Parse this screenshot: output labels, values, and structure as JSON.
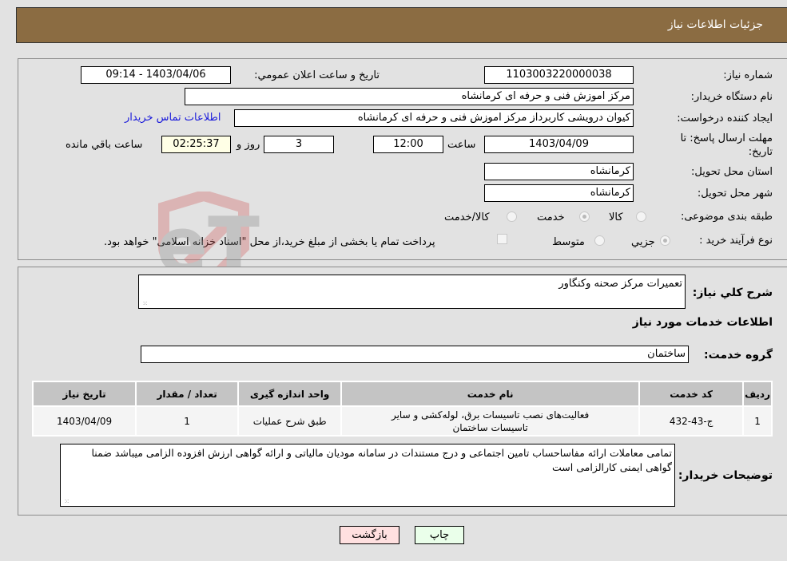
{
  "header": {
    "title": "جزئيات اطلاعات نياز"
  },
  "form": {
    "need_number": {
      "label": "شماره نياز:",
      "value": "1103003220000038"
    },
    "announce_datetime": {
      "label": "تاريخ و ساعت اعلان عمومي:",
      "value": "1403/04/06 - 09:14"
    },
    "buyer_org": {
      "label": "نام دستگاه خريدار:",
      "value": "مرکز اموزش فنی و حرفه ای کرمانشاه"
    },
    "requester": {
      "label": "ايجاد کننده درخواست:",
      "value": "کیوان درویشی کاربرداز مرکز اموزش فنی و حرفه ای کرمانشاه"
    },
    "buyer_contact_link": "اطلاعات تماس خريدار",
    "deadline": {
      "label_line1": "مهلت ارسال پاسخ: تا",
      "label_line2": "تاريخ:",
      "date": "1403/04/09",
      "time_label": "ساعت",
      "time": "12:00",
      "days": "3",
      "days_label": "روز و",
      "remaining": "02:25:37",
      "remaining_label": "ساعت باقي مانده"
    },
    "province": {
      "label": "استان محل تحويل:",
      "value": "کرمانشاه"
    },
    "city": {
      "label": "شهر محل تحويل:",
      "value": "کرمانشاه"
    },
    "category": {
      "label": "طبقه بندی موضوعی:",
      "options": [
        "کالا",
        "خدمت",
        "کالا/خدمت"
      ],
      "selected": "خدمت"
    },
    "purchase_type": {
      "label": "نوع فرآيند خريد :",
      "options": [
        "جزيي",
        "متوسط"
      ],
      "selected": "جزيي",
      "treasury_checkbox_label": "پرداخت تمام يا بخشی از مبلغ خريد،از محل \"اسناد خزانه اسلامی\" خواهد بود.",
      "treasury_checked": false
    }
  },
  "details": {
    "summary_label": "شرح کلي نياز:",
    "summary_value": "تعمیرات مرکز صحنه وکنگاور",
    "services_heading": "اطلاعات خدمات مورد نياز",
    "service_group_label": "گروه خدمت:",
    "service_group_value": "ساختمان",
    "table": {
      "columns": [
        "رديف",
        "کد خدمت",
        "نام خدمت",
        "واحد اندازه گيری",
        "تعداد / مقدار",
        "تاريخ نياز"
      ],
      "rows": [
        [
          "1",
          "ج-43-432",
          "فعالیت‌های نصب تاسیسات برق، لوله‌کشی و سایر تاسیسات ساختمان",
          "طبق شرح عملیات",
          "1",
          "1403/04/09"
        ]
      ]
    },
    "buyer_notes_label": "توضيحات خريدار:",
    "buyer_notes_value": "تمامی معاملات ارائه مفاساحساب تامین اجتماعی و درج مستندات در سامانه مودیان مالیاتی و ارائه گواهی ارزش افزوده الزامی میباشد ضمنا گواهی ایمنی کارالزامی است"
  },
  "buttons": {
    "print": "چاپ",
    "back": "بازگشت"
  },
  "watermark": {
    "text": "AriaTender.neT"
  },
  "colors": {
    "header_bg": "#8b6c42",
    "print_bg": "#eaffea",
    "back_bg": "#ffe0e0",
    "link": "#1a1adb"
  }
}
